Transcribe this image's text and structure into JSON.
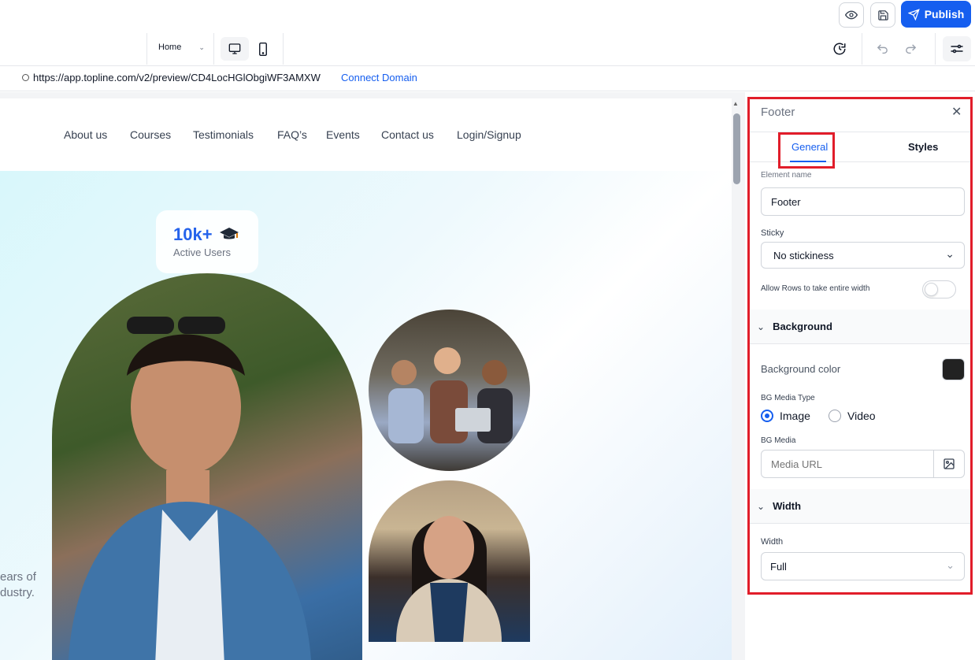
{
  "header": {
    "publish_label": "Publish",
    "page_select": "Home"
  },
  "url_bar": {
    "url": "https://app.topline.com/v2/preview/CD4LocHGlObgiWF3AMXW",
    "connect_label": "Connect Domain"
  },
  "site": {
    "nav": [
      "About us",
      "Courses",
      "Testimonials",
      "FAQ’s",
      "Events",
      "Contact us",
      "Login/Signup"
    ],
    "stat": {
      "value": "10k+",
      "label": "Active Users"
    },
    "hero_text": [
      "ears of",
      "dustry."
    ]
  },
  "panel": {
    "title": "Footer",
    "tabs": {
      "general": "General",
      "styles": "Styles"
    },
    "element_name": {
      "label": "Element name",
      "value": "Footer"
    },
    "sticky": {
      "label": "Sticky",
      "value": "No stickiness"
    },
    "allow_rows": {
      "label": "Allow Rows to take entire width",
      "enabled": false
    },
    "background": {
      "section": "Background",
      "color_label": "Background color",
      "color": "#222222",
      "media_type_label": "BG Media Type",
      "media_types": [
        "Image",
        "Video"
      ],
      "media_label": "BG Media",
      "media_placeholder": "Media URL"
    },
    "width": {
      "section": "Width",
      "label": "Width",
      "value": "Full"
    }
  },
  "colors": {
    "accent": "#155eef",
    "highlight": "#e11d2a"
  }
}
